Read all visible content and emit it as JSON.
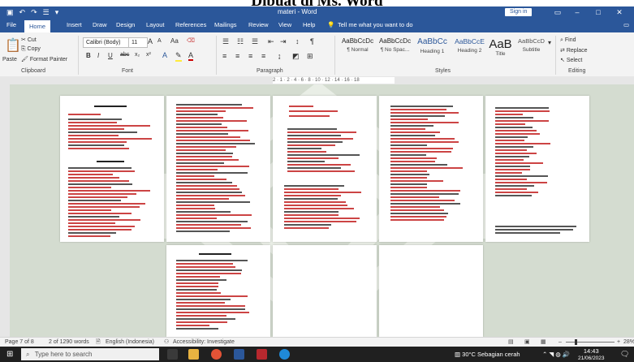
{
  "caption": "Dibuat di Ms. Word",
  "titlebar": {
    "document": "materi - Word",
    "sign_in": "Sign in",
    "quick_access": [
      "save-icon",
      "undo-icon",
      "redo-icon",
      "list-icon",
      "customize-icon"
    ]
  },
  "menu_tabs": [
    "File",
    "Home",
    "Insert",
    "Draw",
    "Design",
    "Layout",
    "References",
    "Mailings",
    "Review",
    "View",
    "Help"
  ],
  "active_tab": "Home",
  "tell_me": "Tell me what you want to do",
  "ribbon": {
    "clipboard": {
      "paste": "Paste",
      "cut": "Cut",
      "copy": "Copy",
      "format_painter": "Format Painter",
      "label": "Clipboard"
    },
    "font": {
      "name": "Calibri (Body)",
      "size": "11",
      "label": "Font",
      "grow": "A",
      "shrink": "A",
      "case": "Aa",
      "bold": "B",
      "italic": "I",
      "underline": "U",
      "strike": "abc",
      "subscript": "x₂",
      "superscript": "x²"
    },
    "paragraph": {
      "label": "Paragraph"
    },
    "styles": {
      "label": "Styles",
      "items": [
        {
          "sample": "AaBbCcDc",
          "name": "¶ Normal"
        },
        {
          "sample": "AaBbCcDc",
          "name": "¶ No Spac..."
        },
        {
          "sample": "AaBbCc",
          "name": "Heading 1"
        },
        {
          "sample": "AaBbCcE",
          "name": "Heading 2"
        },
        {
          "sample": "AaB",
          "name": "Title"
        },
        {
          "sample": "AaBbCcD",
          "name": "Subtitle"
        }
      ]
    },
    "editing": {
      "find": "Find",
      "replace": "Replace",
      "select": "Select",
      "label": "Editing"
    }
  },
  "ruler_ticks": "2 · 1 · 2 · 4 · 6 · 8 · 10 · 12 · 14 · 16 · 18",
  "status": {
    "page": "Page 7 of 8",
    "words": "2 of 1290 words",
    "language": "English (Indonesia)",
    "accessibility": "Accessibility: Investigate",
    "zoom": "28%"
  },
  "taskbar": {
    "search_placeholder": "Type here to search",
    "weather": "30°C  Sebagian cerah",
    "time": "14:43",
    "date": "21/06/2023"
  },
  "colors": {
    "word_blue": "#2b579a",
    "canvas": "#d4dcd0",
    "taskbar": "#202020",
    "text_red": "#c44"
  }
}
